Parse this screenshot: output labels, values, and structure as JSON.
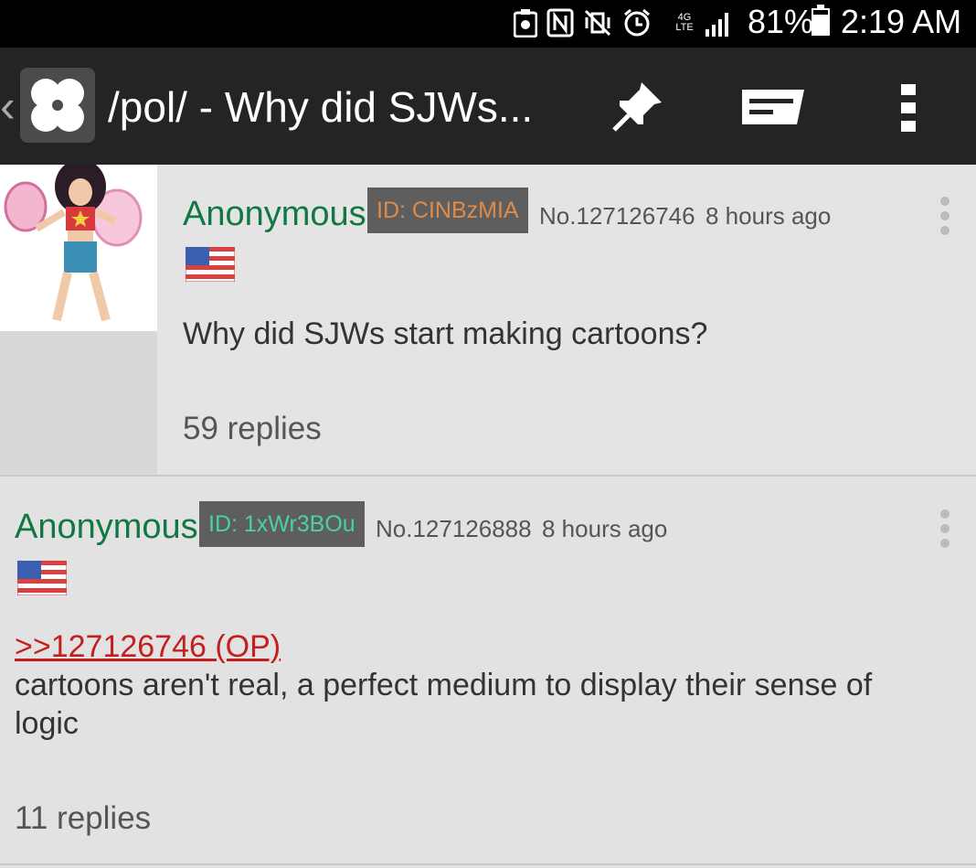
{
  "status_bar": {
    "icons": [
      "blocking-mode-icon",
      "nfc-icon",
      "vibrate-icon",
      "alarm-icon",
      "4g-lte-icon",
      "signal-icon"
    ],
    "network_label": "4G LTE",
    "battery": "81%",
    "time": "2:19 AM"
  },
  "app_bar": {
    "back_glyph": "‹",
    "title": "/pol/ - Why did SJWs..."
  },
  "posts": [
    {
      "name": "Anonymous",
      "id_label": "ID: CINBzMIA",
      "id_color": "#e08a47",
      "post_no": "No.127126746",
      "age": "8 hours ago",
      "body": "Why did SJWs start making cartoons?",
      "replies": "59 replies"
    },
    {
      "name": "Anonymous",
      "id_label": "ID: 1xWr3BOu",
      "id_color": "#49d0a6",
      "post_no": "No.127126888",
      "age": "8 hours ago",
      "quote": ">>127126746 (OP)",
      "body_line1": "cartoons aren't real, a perfect medium to display their sense of",
      "body_line2": "logic",
      "replies": "11 replies"
    }
  ],
  "colors": {
    "name": "#117743",
    "quote": "#c41e1e",
    "appbar": "#242424",
    "background": "#e2e2e2"
  }
}
